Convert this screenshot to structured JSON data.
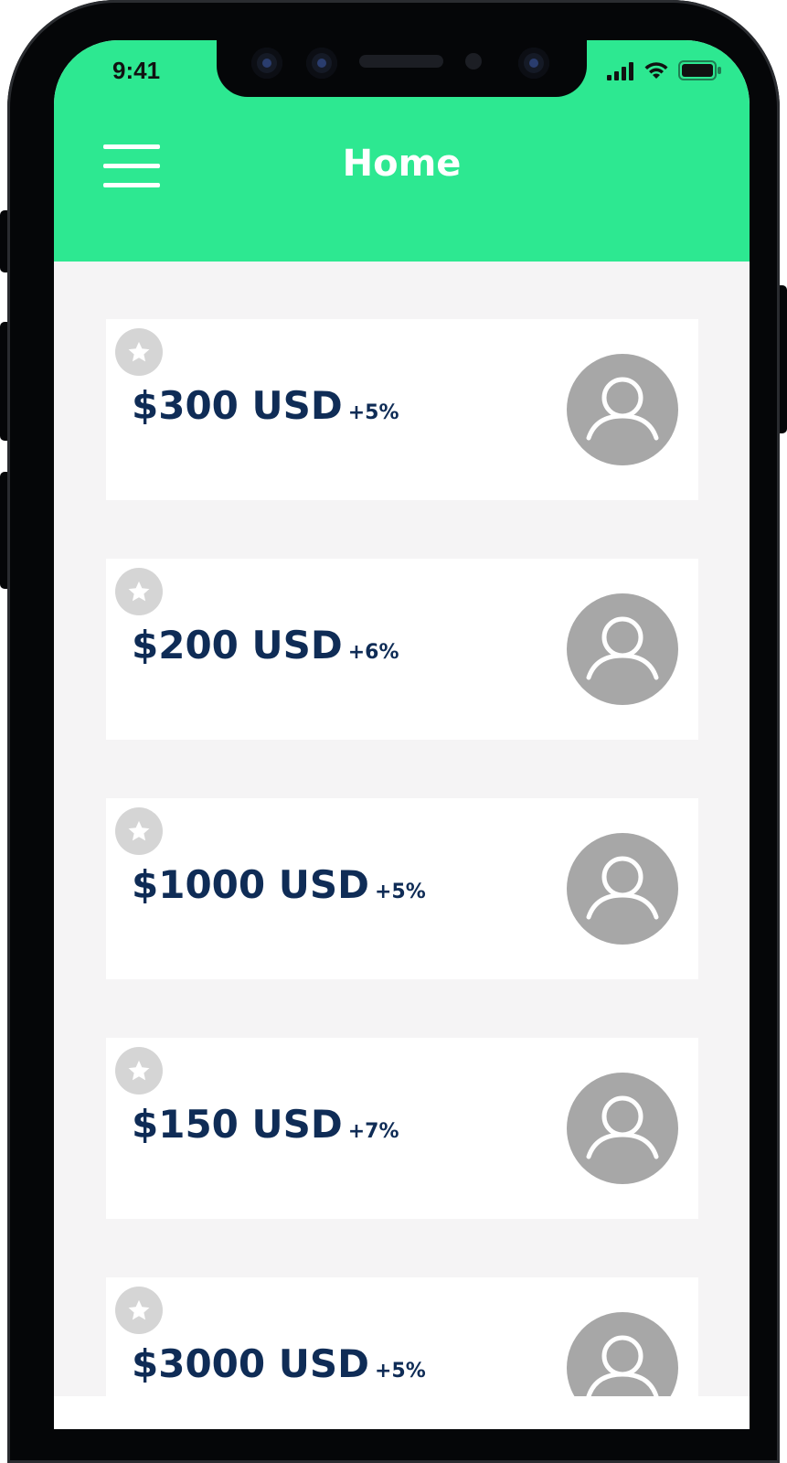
{
  "status_bar": {
    "time": "9:41"
  },
  "header": {
    "title": "Home",
    "background_color": "#2de891",
    "menu_icon": "hamburger-menu-icon"
  },
  "list": {
    "items": [
      {
        "amount": "$300 USD",
        "change": "+5%",
        "starred": false,
        "avatar_icon": "user-avatar-icon"
      },
      {
        "amount": "$200 USD",
        "change": "+6%",
        "starred": false,
        "avatar_icon": "user-avatar-icon"
      },
      {
        "amount": "$1000 USD",
        "change": "+5%",
        "starred": false,
        "avatar_icon": "user-avatar-icon"
      },
      {
        "amount": "$150 USD",
        "change": "+7%",
        "starred": false,
        "avatar_icon": "user-avatar-icon"
      },
      {
        "amount": "$3000 USD",
        "change": "+5%",
        "starred": false,
        "avatar_icon": "user-avatar-icon"
      }
    ]
  },
  "colors": {
    "accent": "#2de891",
    "amount_text": "#0f2c56",
    "avatar_gray": "#a7a7a7",
    "star_gray": "#d5d5d5"
  }
}
